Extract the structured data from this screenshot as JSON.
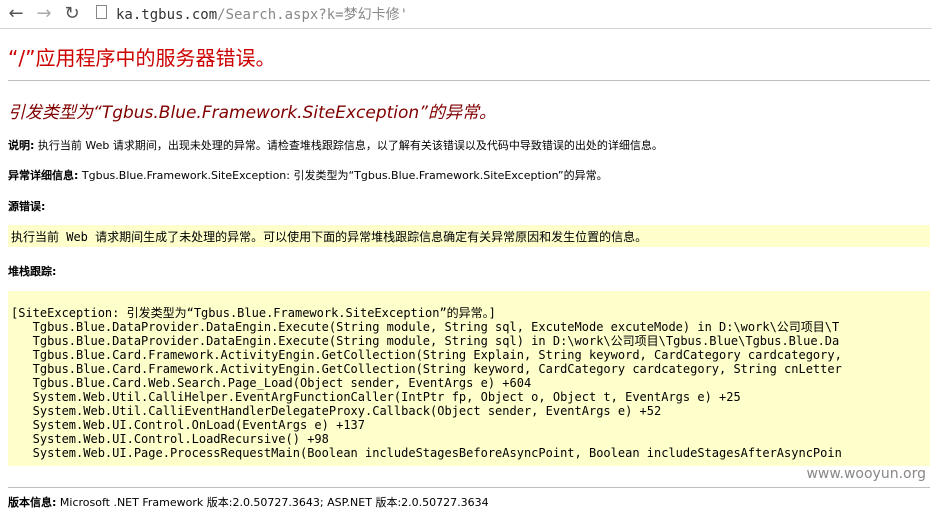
{
  "browser": {
    "url_host": "ka.tgbus.com",
    "url_path": "/Search.aspx?k=梦幻卡修'"
  },
  "page": {
    "title": "“/”应用程序中的服务器错误。",
    "exception_heading": "引发类型为“Tgbus.Blue.Framework.SiteException”的异常。",
    "description_label": "说明:",
    "description_text": "执行当前 Web 请求期间，出现未处理的异常。请检查堆栈跟踪信息，以了解有关该错误以及代码中导致错误的出处的详细信息。",
    "exception_details_label": "异常详细信息:",
    "exception_details_text": "Tgbus.Blue.Framework.SiteException: 引发类型为“Tgbus.Blue.Framework.SiteException”的异常。",
    "source_error_label": "源错误:",
    "source_error_text": "执行当前 Web 请求期间生成了未处理的异常。可以使用下面的异常堆栈跟踪信息确定有关异常原因和发生位置的信息。",
    "stack_trace_label": "堆栈跟踪:",
    "stack_trace_lines": [
      "[SiteException: 引发类型为“Tgbus.Blue.Framework.SiteException”的异常。]",
      "   Tgbus.Blue.DataProvider.DataEngin.Execute(String module, String sql, ExcuteMode excuteMode) in D:\\work\\公司项目\\T",
      "   Tgbus.Blue.DataProvider.DataEngin.Execute(String module, String sql) in D:\\work\\公司项目\\Tgbus.Blue\\Tgbus.Blue.Da",
      "   Tgbus.Blue.Card.Framework.ActivityEngin.GetCollection(String Explain, String keyword, CardCategory cardcategory,",
      "   Tgbus.Blue.Card.Framework.ActivityEngin.GetCollection(String keyword, CardCategory cardcategory, String cnLetter",
      "   Tgbus.Blue.Card.Web.Search.Page_Load(Object sender, EventArgs e) +604",
      "   System.Web.Util.CalliHelper.EventArgFunctionCaller(IntPtr fp, Object o, Object t, EventArgs e) +25",
      "   System.Web.Util.CalliEventHandlerDelegateProxy.Callback(Object sender, EventArgs e) +52",
      "   System.Web.UI.Control.OnLoad(EventArgs e) +137",
      "   System.Web.UI.Control.LoadRecursive() +98",
      "   System.Web.UI.Page.ProcessRequestMain(Boolean includeStagesBeforeAsyncPoint, Boolean includeStagesAfterAsyncPoin"
    ],
    "version_label": "版本信息:",
    "version_text": "Microsoft .NET Framework 版本:2.0.50727.3643; ASP.NET 版本:2.0.50727.3634"
  },
  "watermark": "www.wooyun.org",
  "colors": {
    "title": "#cc0000",
    "heading": "#800000",
    "code_bg": "#ffffcc"
  }
}
